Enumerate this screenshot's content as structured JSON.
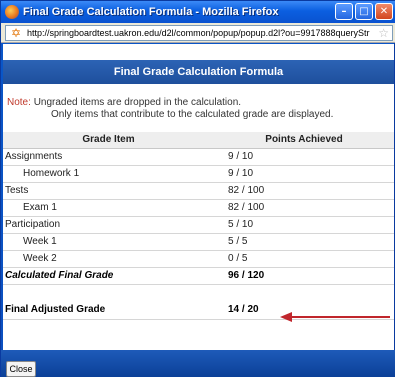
{
  "window": {
    "title": "Final Grade Calculation Formula - Mozilla Firefox",
    "minimize_icon": "minimize-icon",
    "maximize_icon": "maximize-icon",
    "close_icon": "close-icon"
  },
  "address_bar": {
    "url": "http://springboardtest.uakron.edu/d2l/common/popup/popup.d2l?ou=9917888queryStr"
  },
  "page": {
    "header": "Final Grade Calculation Formula",
    "note_label": "Note:",
    "note_line1": "Ungraded items are dropped in the calculation.",
    "note_line2": "Only items that contribute to the calculated grade are displayed."
  },
  "table": {
    "headers": [
      "Grade Item",
      "Points Achieved"
    ],
    "rows": [
      {
        "item": "Assignments",
        "points": "9 / 10"
      },
      {
        "item": "Homework 1",
        "points": "9 / 10"
      },
      {
        "item": "Tests",
        "points": "82 / 100"
      },
      {
        "item": "Exam 1",
        "points": "82 / 100"
      },
      {
        "item": "Participation",
        "points": "5 / 10"
      },
      {
        "item": "Week 1",
        "points": "5 / 5"
      },
      {
        "item": "Week 2",
        "points": "0 / 5"
      }
    ],
    "calculated": {
      "item": "Calculated Final Grade",
      "points": "96 / 120"
    },
    "final": {
      "item": "Final Adjusted Grade",
      "points": "14 / 20"
    }
  },
  "footer": {
    "close_label": "Close"
  },
  "colors": {
    "annotation_arrow": "#c0262c",
    "header_bg": "#2c63b5",
    "note_label": "#c0392b"
  }
}
